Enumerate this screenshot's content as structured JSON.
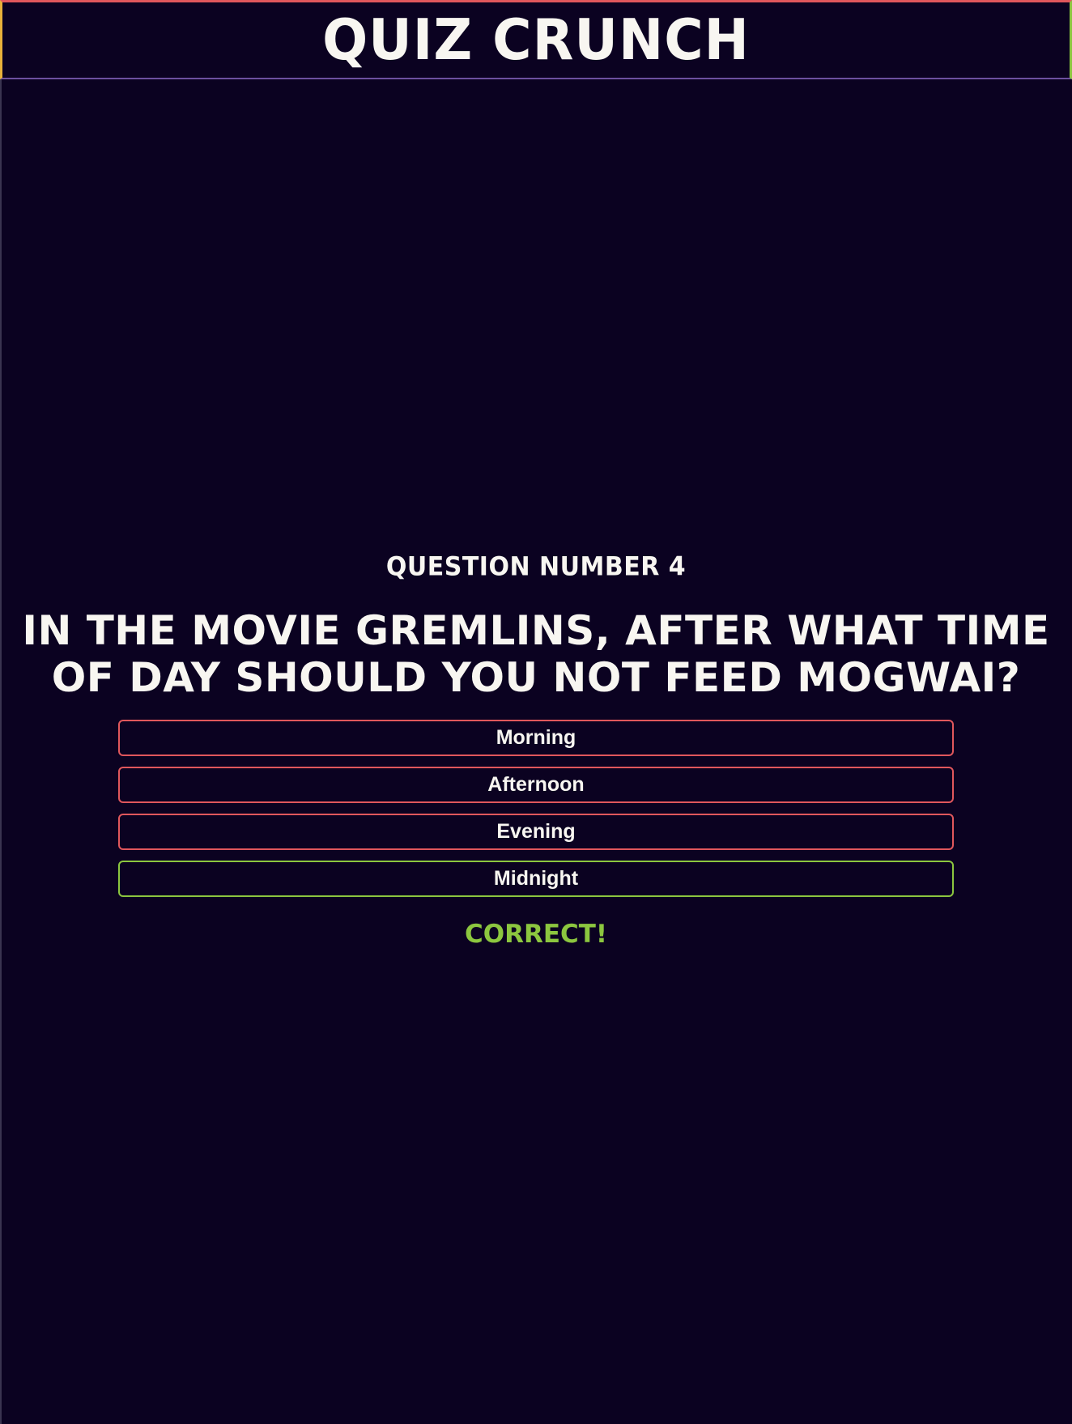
{
  "header": {
    "title": "Quiz Crunch"
  },
  "quiz": {
    "question_number_label": "Question Number 4",
    "question": "In the movie Gremlins, after what time of day should you not feed Mogwai?",
    "answers": [
      {
        "label": "Morning",
        "status": "incorrect"
      },
      {
        "label": "Afternoon",
        "status": "incorrect"
      },
      {
        "label": "Evening",
        "status": "incorrect"
      },
      {
        "label": "Midnight",
        "status": "correct"
      }
    ],
    "result": "Correct!"
  },
  "colors": {
    "background": "#0b0221",
    "text": "#f8f6f1",
    "incorrect_border": "#e0575c",
    "correct": "#8cc63f",
    "header_left_border": "#e8b13a",
    "header_bottom_border": "#6c4f9e"
  }
}
